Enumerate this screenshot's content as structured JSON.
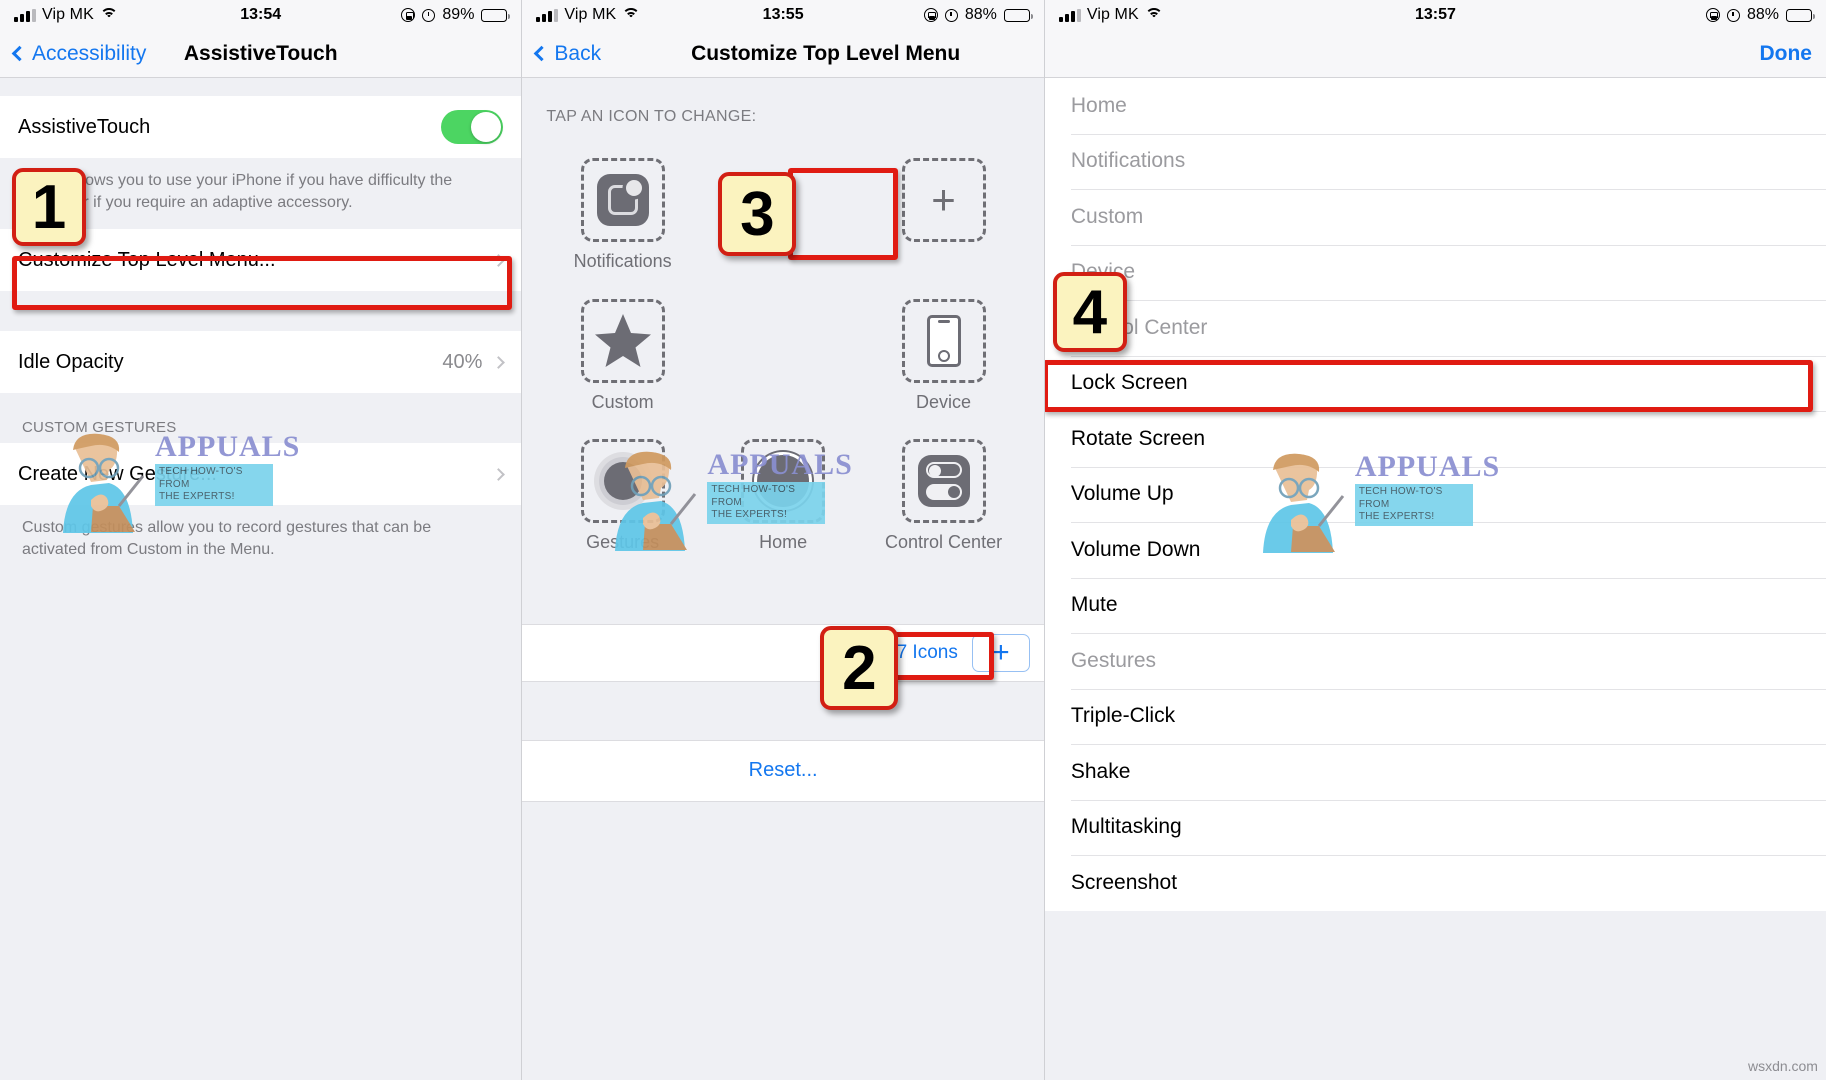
{
  "screens": {
    "left": {
      "status": {
        "carrier": "Vip MK",
        "time": "13:54",
        "battery": "89%"
      },
      "nav": {
        "back": "Accessibility",
        "title": "AssistiveTouch"
      },
      "rows": {
        "assistivetouch_label": "AssistiveTouch",
        "description": "Touch allows you to use your iPhone if you have difficulty the screen or if you require an adaptive accessory.",
        "customize_menu": "Customize Top Level Menu...",
        "idle_opacity_label": "Idle Opacity",
        "idle_opacity_value": "40%",
        "custom_gestures_header": "CUSTOM GESTURES",
        "create_new_gesture": "Create New Gesture...",
        "gestures_footnote": "Custom gestures allow you to record gestures that can be activated from Custom in the Menu."
      }
    },
    "middle": {
      "status": {
        "carrier": "Vip MK",
        "time": "13:55",
        "battery": "88%"
      },
      "nav": {
        "back": "Back",
        "title": "Customize Top Level Menu"
      },
      "tap_hint": "TAP AN ICON TO CHANGE:",
      "icons": [
        {
          "label": "Notifications",
          "icon": "notifications-icon"
        },
        {
          "label": "",
          "icon": "plus-icon"
        },
        {
          "label": "Custom",
          "icon": "star-icon"
        },
        {
          "label": "Device",
          "icon": "device-icon"
        },
        {
          "label": "Gestures",
          "icon": "gestures-icon"
        },
        {
          "label": "Home",
          "icon": "home-icon"
        },
        {
          "label": "Control Center",
          "icon": "control-center-icon"
        }
      ],
      "count_label": "7 Icons",
      "add_button": "+",
      "reset_label": "Reset..."
    },
    "right": {
      "status": {
        "carrier": "Vip MK",
        "time": "13:57",
        "battery": "88%"
      },
      "nav": {
        "done": "Done"
      },
      "options": [
        {
          "label": "Home",
          "disabled": true
        },
        {
          "label": "Notifications",
          "disabled": true
        },
        {
          "label": "Custom",
          "disabled": true
        },
        {
          "label": "Device",
          "disabled": true
        },
        {
          "label": "Control Center",
          "disabled": true
        },
        {
          "label": "Lock Screen",
          "disabled": false
        },
        {
          "label": "Rotate Screen",
          "disabled": false
        },
        {
          "label": "Volume Up",
          "disabled": false
        },
        {
          "label": "Volume Down",
          "disabled": false
        },
        {
          "label": "Mute",
          "disabled": false
        },
        {
          "label": "Gestures",
          "disabled": true
        },
        {
          "label": "Triple-Click",
          "disabled": false
        },
        {
          "label": "Shake",
          "disabled": false
        },
        {
          "label": "Multitasking",
          "disabled": false
        },
        {
          "label": "Screenshot",
          "disabled": false
        }
      ]
    }
  },
  "annotations": {
    "b1": "1",
    "b2": "2",
    "b3": "3",
    "b4": "4"
  },
  "watermarks": {
    "brand": "APPUALS",
    "tagline_line1": "TECH HOW-TO'S FROM",
    "tagline_line2": "THE EXPERTS!",
    "site": "wsxdn.com"
  },
  "colors": {
    "accent": "#1477ef",
    "toggle_on": "#4cd562",
    "annotation_red": "#e01b12",
    "badge_yellow": "#fbf3bf"
  }
}
